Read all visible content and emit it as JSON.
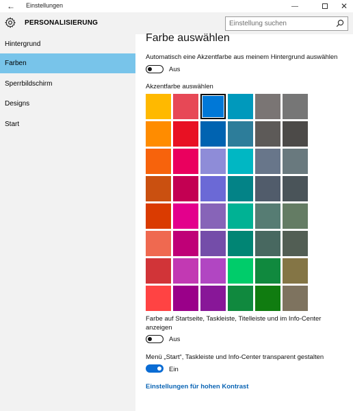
{
  "window": {
    "title": "Einstellungen",
    "back_icon": "arrow-left-icon",
    "controls": [
      "minimize-icon",
      "maximize-icon",
      "close-icon"
    ]
  },
  "header": {
    "section_title": "PERSONALISIERUNG",
    "icon": "gear-icon",
    "search": {
      "placeholder": "Einstellung suchen",
      "value": "",
      "icon": "search-icon"
    }
  },
  "sidebar": {
    "items": [
      {
        "label": "Hintergrund",
        "active": false
      },
      {
        "label": "Farben",
        "active": true
      },
      {
        "label": "Sperrbildschirm",
        "active": false
      },
      {
        "label": "Designs",
        "active": false
      },
      {
        "label": "Start",
        "active": false
      }
    ],
    "active_color": "#78c4ea"
  },
  "main": {
    "title": "Farbe auswählen",
    "auto_accent": {
      "label": "Automatisch eine Akzentfarbe aus meinem Hintergrund auswählen",
      "state": "Aus",
      "on": false
    },
    "accent_heading": "Akzentfarbe auswählen",
    "selected_index": 2,
    "swatches": [
      "#ffb900",
      "#e74856",
      "#0078d7",
      "#0099bc",
      "#7a7574",
      "#767676",
      "#ff8c00",
      "#e81123",
      "#0063b1",
      "#2d7d9a",
      "#5d5a58",
      "#4c4a48",
      "#f7630c",
      "#ea005e",
      "#8e8cd8",
      "#00b7c3",
      "#68768a",
      "#69797e",
      "#ca5010",
      "#c30052",
      "#6b69d6",
      "#038387",
      "#515c6b",
      "#4a5459",
      "#da3b01",
      "#e3008c",
      "#8764b8",
      "#00b294",
      "#567c73",
      "#647c64",
      "#ef6950",
      "#bf0077",
      "#744da9",
      "#018574",
      "#486860",
      "#525e54",
      "#d13438",
      "#c239b3",
      "#b146c2",
      "#00cc6a",
      "#10893e",
      "#847545",
      "#ff4343",
      "#9a0089",
      "#881798",
      "#10893e",
      "#107c10",
      "#7e735f"
    ],
    "show_color": {
      "label_line1": "Farbe auf Startseite, Taskleiste, Titelleiste und im Info-Center",
      "label_line2": "anzeigen",
      "state": "Aus",
      "on": false
    },
    "transparent": {
      "label": "Menü „Start“, Taskleiste und Info-Center transparent gestalten",
      "state": "Ein",
      "on": true
    },
    "contrast_link": "Einstellungen für hohen Kontrast",
    "link_color": "#0a64b4",
    "toggle_on_color": "#0a6cd4"
  }
}
